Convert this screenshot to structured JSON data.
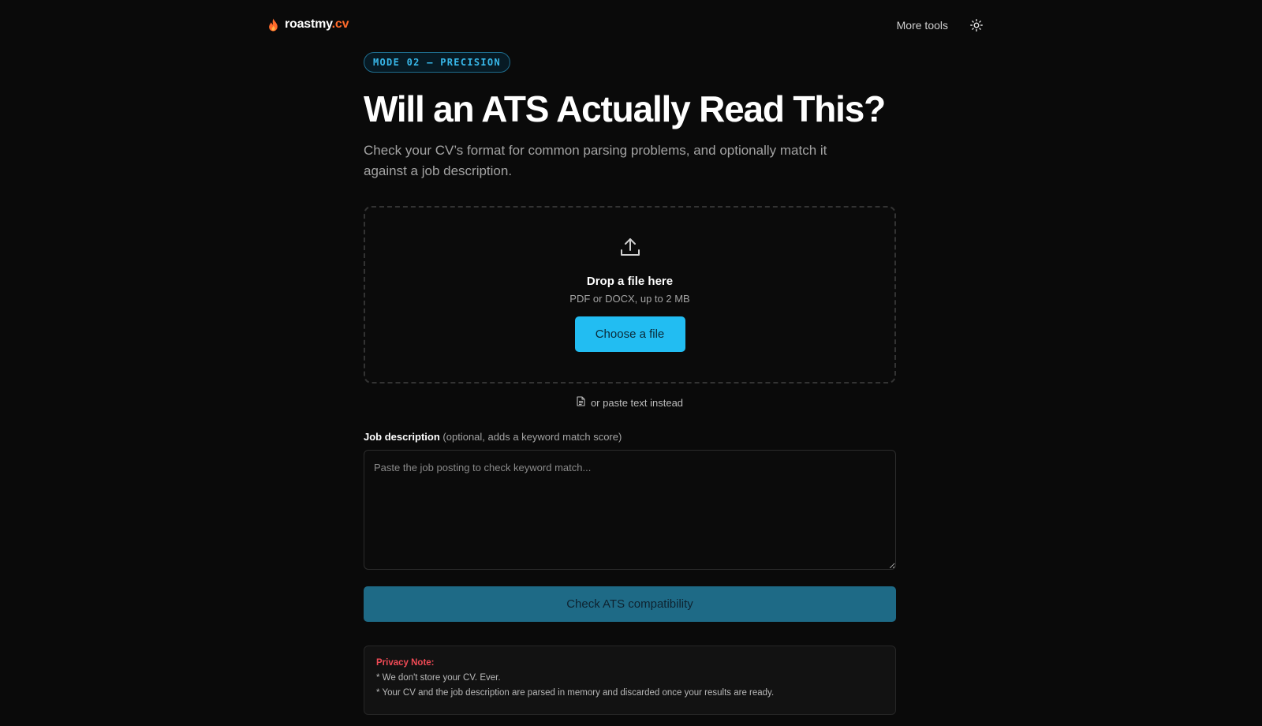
{
  "header": {
    "brand_name": "roastmy",
    "brand_ext": ".cv",
    "more_tools_label": "More tools",
    "icons": {
      "logo": "flame-icon",
      "theme": "sun-icon"
    }
  },
  "hero": {
    "mode_badge": "MODE 02 — PRECISION",
    "title": "Will an ATS Actually Read This?",
    "subtitle": "Check your CV’s format for common parsing problems, and optionally match it against a job description."
  },
  "upload": {
    "icon": "upload-icon",
    "title": "Drop a file here",
    "hint": "PDF or DOCX, up to 2 MB",
    "button_label": "Choose a file",
    "paste_link": "or paste text instead",
    "paste_icon": "document-icon"
  },
  "job_description": {
    "label": "Job description",
    "label_note": "(optional, adds a keyword match score)",
    "placeholder": "Paste the job posting to check keyword match...",
    "value": ""
  },
  "actions": {
    "check_label": "Check ATS compatibility"
  },
  "privacy": {
    "title": "Privacy Note:",
    "lines": [
      "* We don't store your CV. Ever.",
      "* Your CV and the job description are parsed in memory and discarded once your results are ready."
    ]
  },
  "colors": {
    "background": "#0a0a0a",
    "accent": "#22bdf2",
    "accent_dark": "#1e6a86",
    "brand_orange": "#ff6a2b",
    "privacy_red": "#f04a55"
  }
}
